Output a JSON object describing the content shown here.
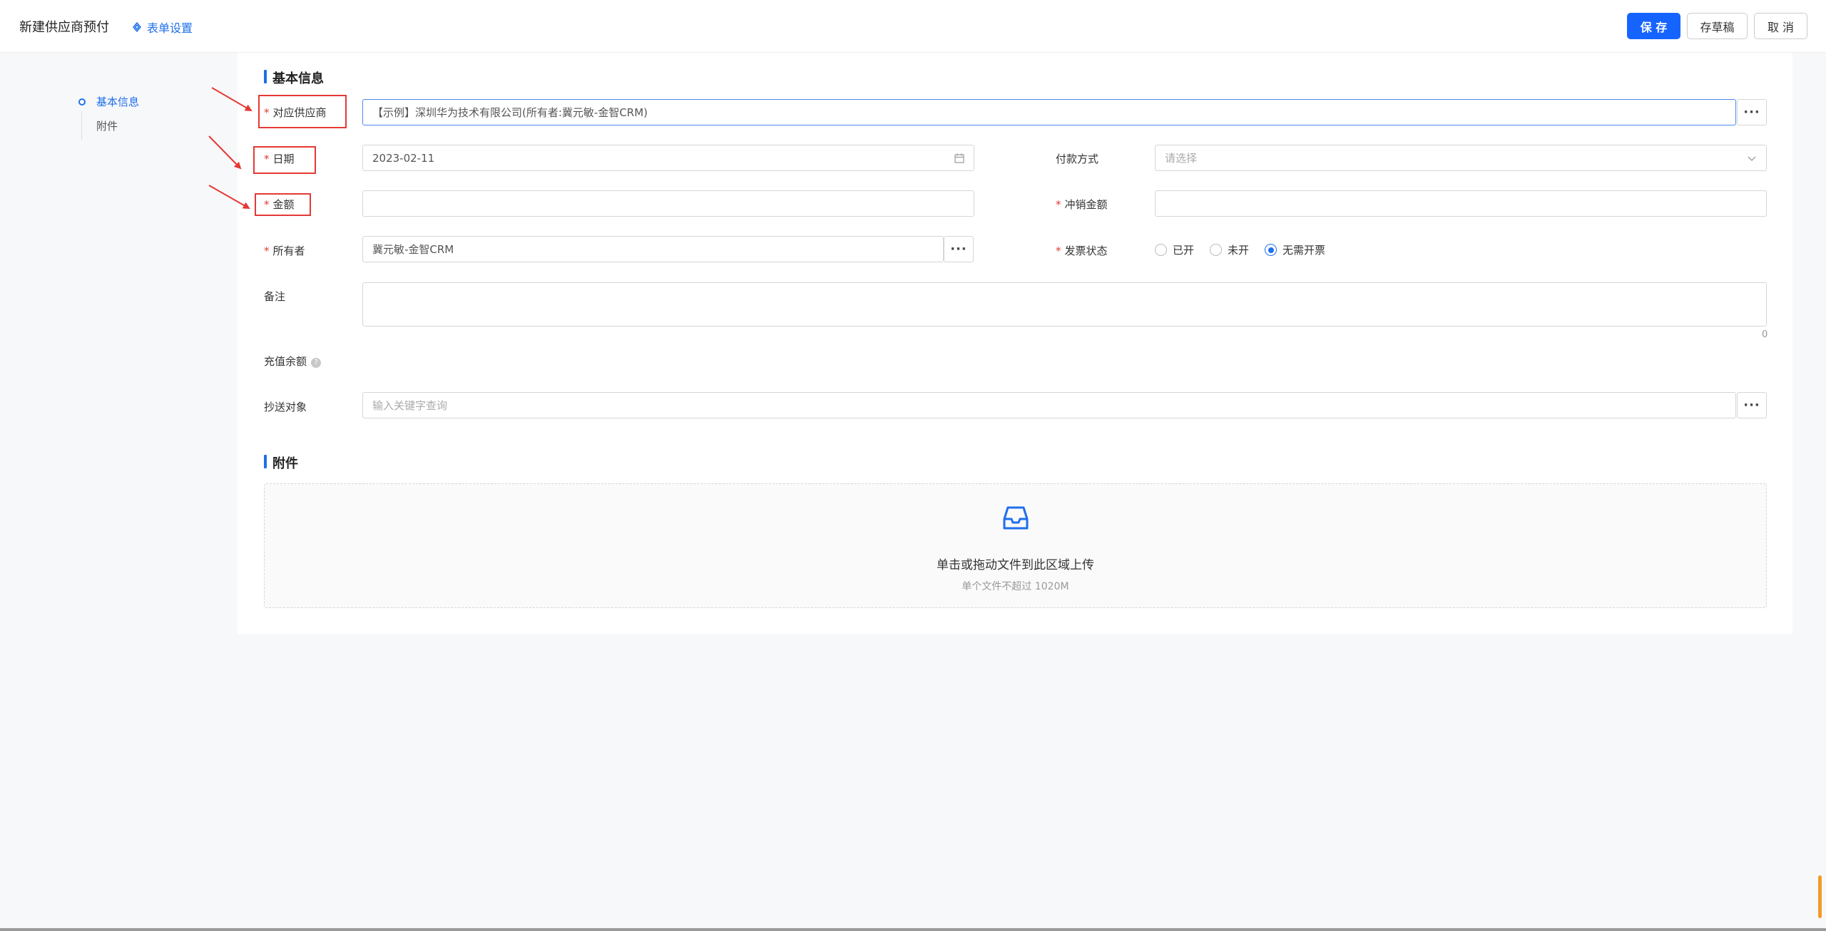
{
  "header": {
    "title": "新建供应商预付",
    "form_settings": "表单设置",
    "save": "保 存",
    "draft": "存草稿",
    "cancel": "取 消"
  },
  "sidenav": {
    "items": [
      {
        "label": "基本信息",
        "active": true
      },
      {
        "label": "附件",
        "active": false
      }
    ]
  },
  "basic": {
    "section_title": "基本信息",
    "supplier_label": "对应供应商",
    "supplier_value": "【示例】深圳华为技术有限公司(所有者:冀元敏-金智CRM)",
    "date_label": "日期",
    "date_value": "2023-02-11",
    "payment_label": "付款方式",
    "payment_placeholder": "请选择",
    "amount_label": "金额",
    "amount_value": "",
    "writeoff_label": "冲销金额",
    "writeoff_value": "",
    "owner_label": "所有者",
    "owner_value": "冀元敏-金智CRM",
    "invoice_label": "发票状态",
    "invoice_options": [
      "已开",
      "未开",
      "无需开票"
    ],
    "invoice_selected": "无需开票",
    "remark_label": "备注",
    "remark_count": "0",
    "balance_label": "充值余额",
    "cc_label": "抄送对象",
    "cc_placeholder": "输入关键字查询",
    "dots": "···"
  },
  "attachment": {
    "section_title": "附件",
    "upload_text": "单击或拖动文件到此区域上传",
    "upload_hint": "单个文件不超过 1020M"
  },
  "colors": {
    "primary": "#1664ff",
    "required": "#e53935",
    "annotation": "#e53935"
  }
}
